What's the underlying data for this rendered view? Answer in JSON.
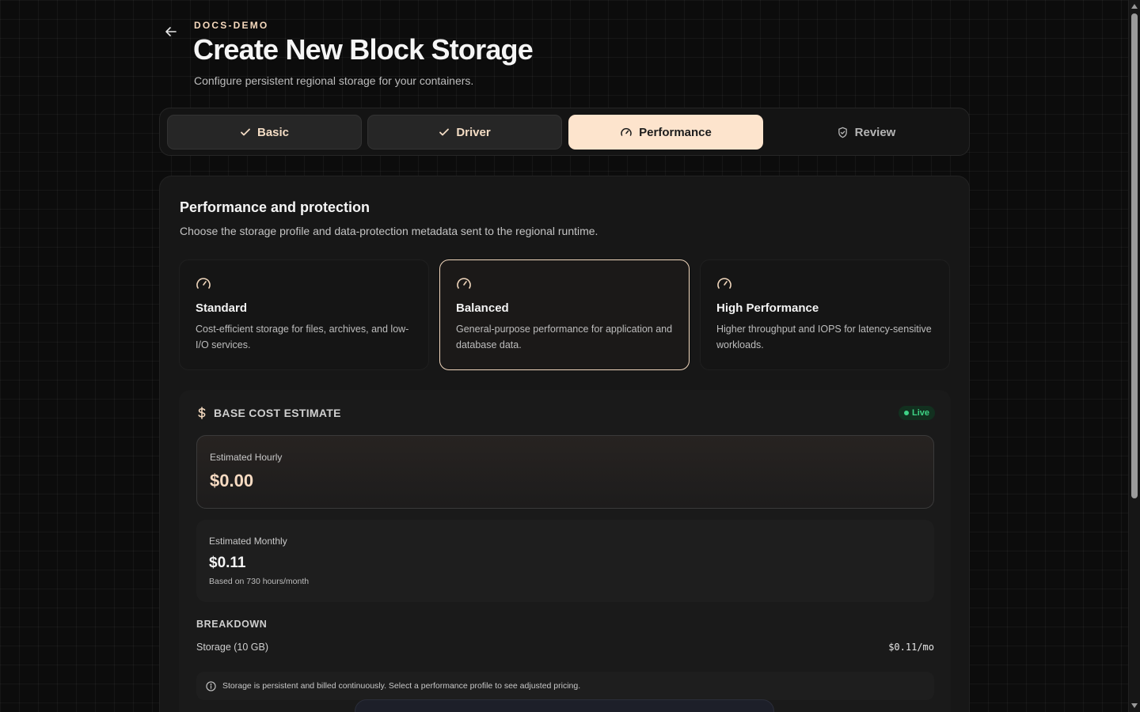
{
  "header": {
    "eyebrow": "DOCS-DEMO",
    "title": "Create New Block Storage",
    "subtitle": "Configure persistent regional storage for your containers."
  },
  "steps": [
    {
      "label": "Basic",
      "state": "done",
      "icon": "check-icon"
    },
    {
      "label": "Driver",
      "state": "done",
      "icon": "check-icon"
    },
    {
      "label": "Performance",
      "state": "active",
      "icon": "gauge-icon"
    },
    {
      "label": "Review",
      "state": "todo",
      "icon": "shield-check-icon"
    }
  ],
  "section": {
    "title": "Performance and protection",
    "description": "Choose the storage profile and data-protection metadata sent to the regional runtime."
  },
  "profiles": [
    {
      "name": "Standard",
      "description": "Cost-efficient storage for files, archives, and low-I/O services.",
      "selected": false,
      "icon": "gauge-icon"
    },
    {
      "name": "Balanced",
      "description": "General-purpose performance for application and database data.",
      "selected": true,
      "icon": "gauge-icon"
    },
    {
      "name": "High Performance",
      "description": "Higher throughput and IOPS for latency-sensitive workloads.",
      "selected": false,
      "icon": "gauge-icon"
    }
  ],
  "estimate": {
    "title": "BASE COST ESTIMATE",
    "badge": "Live",
    "hourly_label": "Estimated Hourly",
    "hourly_value": "$0.00",
    "monthly_label": "Estimated Monthly",
    "monthly_value": "$0.11",
    "monthly_note": "Based on 730 hours/month",
    "breakdown_title": "BREAKDOWN",
    "breakdown_items": [
      {
        "label": "Storage (10 GB)",
        "value": "$0.11/mo"
      }
    ],
    "info": "Storage is persistent and billed continuously. Select a performance profile to see adjusted pricing."
  },
  "colors": {
    "accent": "#fde4cd",
    "accent_text": "#f6d9bd",
    "live": "#3ed486",
    "background": "#0c0c0c"
  }
}
